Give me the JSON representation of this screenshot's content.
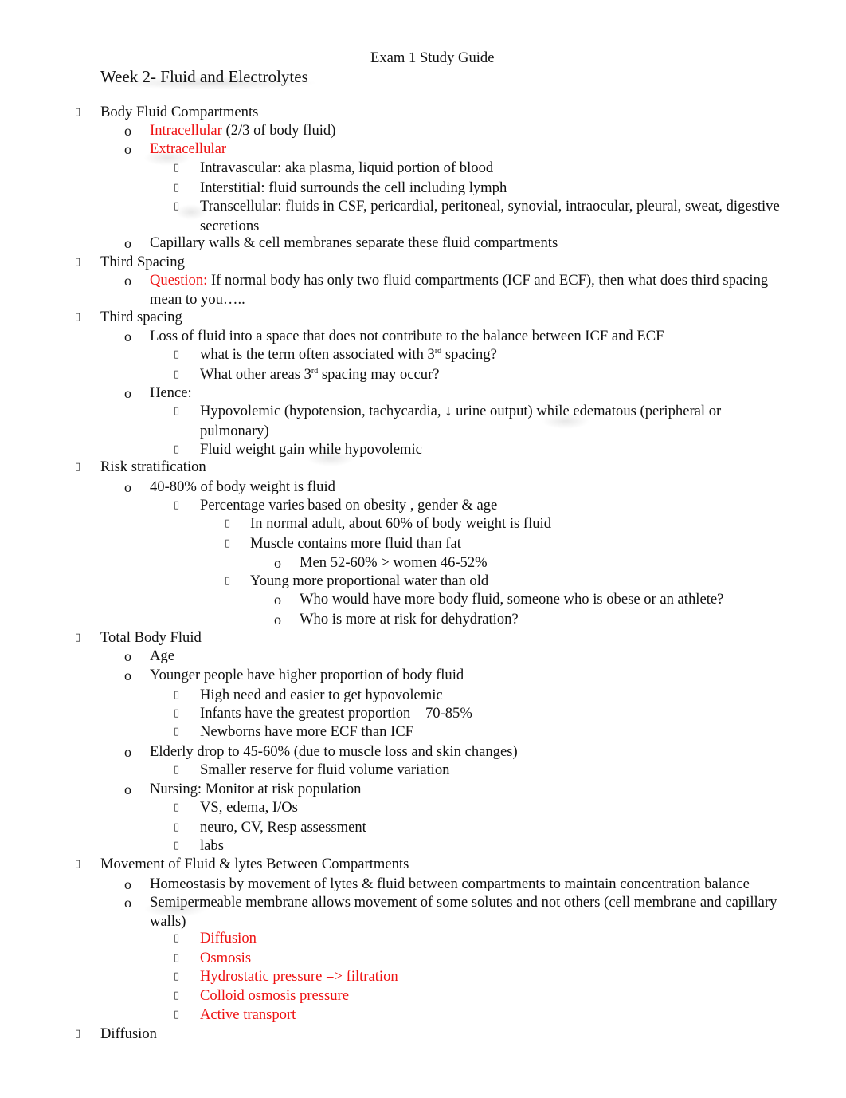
{
  "document": {
    "title": "Exam 1 Study Guide",
    "section_heading": "Week 2- Fluid and Electrolytes",
    "bullet_icons": {
      "level1": "square-bullet-icon",
      "level2": "letter-o-bullet",
      "level3": "square-bullet-icon"
    },
    "colors": {
      "text": "#111111",
      "highlight": "#ee1111"
    }
  },
  "lines": [
    {
      "level": 1,
      "text": "Body Fluid Compartments"
    },
    {
      "level": 2,
      "red": "Intracellular",
      "text": " (2/3 of body fluid)"
    },
    {
      "level": 2,
      "red": "Extracellular",
      "text": ""
    },
    {
      "level": 3,
      "text": "Intravascular: aka plasma, liquid portion of blood"
    },
    {
      "level": 3,
      "text": "Interstitial: fluid surrounds the cell including lymph"
    },
    {
      "level": 3,
      "text": "Transcellular: fluids in CSF, pericardial, peritoneal, synovial, intraocular, pleural, sweat, digestive"
    },
    {
      "level": 3,
      "cont": true,
      "text": "secretions"
    },
    {
      "level": 2,
      "text": "Capillary walls & cell membranes separate these fluid compartments"
    },
    {
      "level": 1,
      "text": "Third Spacing"
    },
    {
      "level": 2,
      "red": "Question:",
      "text": " If normal body has only two fluid compartments (ICF and ECF), then what does third spacing"
    },
    {
      "level": 2,
      "cont": true,
      "text": "mean to you….."
    },
    {
      "level": 1,
      "text": "Third spacing"
    },
    {
      "level": 2,
      "text": "Loss of fluid into a space that does not contribute to the balance between ICF and ECF"
    },
    {
      "level": 3,
      "text": "what is the term often associated with 3",
      "sup": "rd",
      "after": " spacing?"
    },
    {
      "level": 3,
      "text": "What other areas 3",
      "sup": "rd",
      "after": " spacing may occur?"
    },
    {
      "level": 2,
      "text": "Hence:"
    },
    {
      "level": 3,
      "text": "Hypovolemic (hypotension, tachycardia, ↓ urine output) while edematous (peripheral or"
    },
    {
      "level": 3,
      "cont": true,
      "text": "pulmonary)"
    },
    {
      "level": 3,
      "text": "Fluid weight gain while hypovolemic"
    },
    {
      "level": 1,
      "text": "Risk stratification"
    },
    {
      "level": 2,
      "text": "40-80% of body weight is fluid"
    },
    {
      "level": 3,
      "text": "Percentage varies based on obesity , gender  & age"
    },
    {
      "level": 4,
      "text": "In normal adult, about 60% of body weight is fluid"
    },
    {
      "level": 4,
      "text": "Muscle contains more fluid than fat"
    },
    {
      "level": 5,
      "text": "Men 52-60% > women 46-52%"
    },
    {
      "level": 4,
      "text": "Young more proportional water than old"
    },
    {
      "level": 5,
      "text": "Who would have more body fluid, someone who is obese or an athlete?"
    },
    {
      "level": 5,
      "text": "Who is more at risk for dehydration?"
    },
    {
      "level": 1,
      "text": "Total Body Fluid"
    },
    {
      "level": 2,
      "text": "Age"
    },
    {
      "level": 2,
      "text": "Younger people have higher proportion of body fluid"
    },
    {
      "level": 3,
      "text": "High need and easier to get hypovolemic"
    },
    {
      "level": 3,
      "text": "Infants have the greatest proportion – 70-85%"
    },
    {
      "level": 3,
      "text": "Newborns have more ECF than ICF"
    },
    {
      "level": 2,
      "text": "Elderly drop to 45-60% (due to muscle loss and skin changes)"
    },
    {
      "level": 3,
      "text": "Smaller reserve for fluid volume variation"
    },
    {
      "level": 2,
      "text": "Nursing: Monitor at risk population"
    },
    {
      "level": 3,
      "text": "VS, edema, I/Os"
    },
    {
      "level": 3,
      "text": "neuro, CV, Resp assessment"
    },
    {
      "level": 3,
      "text": "labs"
    },
    {
      "level": 1,
      "text": "Movement of Fluid & lytes Between Compartments"
    },
    {
      "level": 2,
      "text": "Homeostasis by movement of lytes & fluid between compartments to maintain concentration balance"
    },
    {
      "level": 2,
      "text": "Semipermeable membrane allows movement of some solutes and not others (cell membrane and capillary"
    },
    {
      "level": 2,
      "cont": true,
      "text": "walls)"
    },
    {
      "level": 3,
      "red": "Diffusion",
      "text": ""
    },
    {
      "level": 3,
      "red": "Osmosis",
      "text": ""
    },
    {
      "level": 3,
      "red": "Hydrostatic pressure => filtration",
      "text": ""
    },
    {
      "level": 3,
      "red": "Colloid osmosis pressure",
      "text": ""
    },
    {
      "level": 3,
      "red": "Active transport",
      "text": ""
    },
    {
      "level": 1,
      "text": "Diffusion"
    }
  ]
}
